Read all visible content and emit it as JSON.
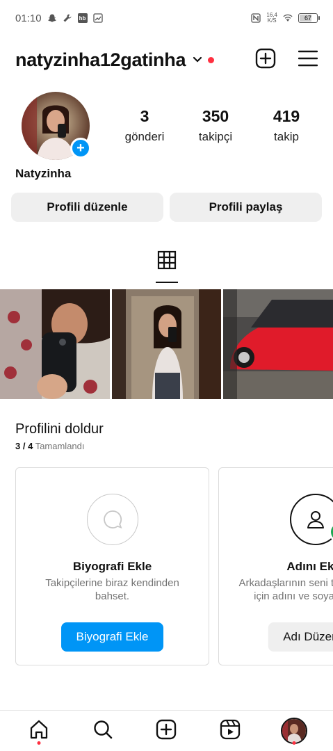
{
  "status_bar": {
    "time": "01:10",
    "net_speed_value": "16,4",
    "net_speed_unit": "K/S",
    "battery": "67",
    "battery_level": 0.67,
    "hb_label": "hb"
  },
  "header": {
    "username": "natyzinha12gatinha"
  },
  "profile": {
    "display_name": "Natyzinha",
    "stats": [
      {
        "value": "3",
        "label": "gönderi"
      },
      {
        "value": "350",
        "label": "takipçi"
      },
      {
        "value": "419",
        "label": "takip"
      }
    ],
    "edit_label": "Profili düzenle",
    "share_label": "Profili paylaş"
  },
  "complete_profile": {
    "title": "Profilini doldur",
    "progress": "3 / 4",
    "progress_suffix": "Tamamlandı",
    "cards": [
      {
        "title": "Biyografi Ekle",
        "description": "Takipçilerine biraz kendinden bahset.",
        "cta": "Biyografi Ekle"
      },
      {
        "title": "Adını Ekle",
        "description": "Arkadaşlarının seni tanıyabilmesi için adını ve soyadını ekle.",
        "cta": "Adı Düzenle"
      }
    ]
  },
  "colors": {
    "accent": "#0095f6",
    "notification": "#ff3040",
    "button_gray": "#efefef",
    "complete_green": "#1fa854"
  }
}
